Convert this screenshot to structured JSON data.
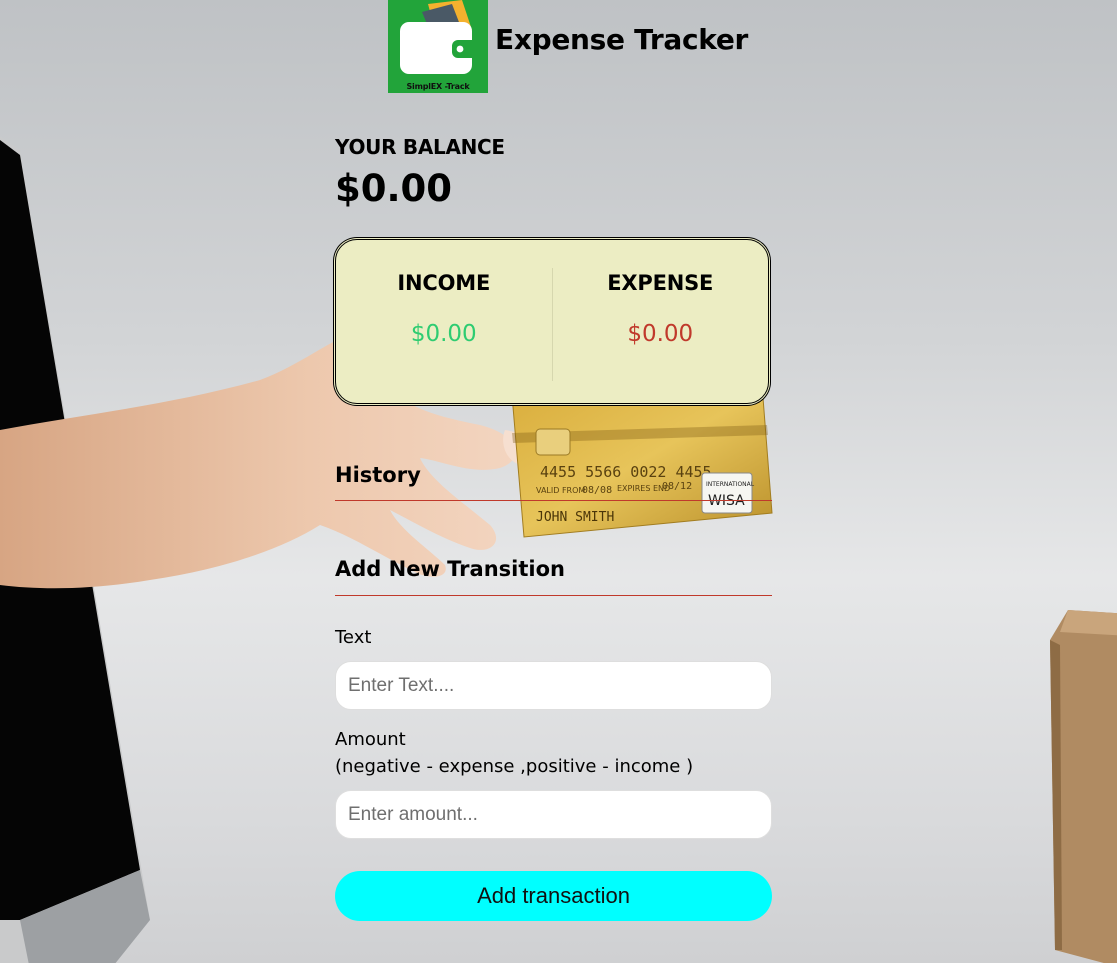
{
  "header": {
    "logo_caption": "SimplEX -Track",
    "title": "Expense Tracker"
  },
  "balance": {
    "label": "YOUR BALANCE",
    "value": "$0.00"
  },
  "summary": {
    "income_label": "INCOME",
    "income_value": "$0.00",
    "expense_label": "EXPENSE",
    "expense_value": "$0.00"
  },
  "history": {
    "title": "History"
  },
  "form": {
    "title": "Add New Transition",
    "text_label": "Text",
    "text_placeholder": "Enter Text....",
    "amount_label": "Amount",
    "amount_hint": "(negative - expense ,positive - income )",
    "amount_placeholder": "Enter amount...",
    "submit_label": "Add transaction"
  },
  "card": {
    "number": "4455 5566 0022 4455",
    "holder": "JOHN SMITH",
    "valid_from": "08/08",
    "expires": "08/12",
    "brand": "WISA",
    "brand_note": "INTERNATIONAL"
  },
  "colors": {
    "income": "#2ecc71",
    "expense": "#c0392b",
    "summary_bg": "#ecedc3",
    "button": "#00ffff",
    "logo_bg": "#22a43a"
  }
}
